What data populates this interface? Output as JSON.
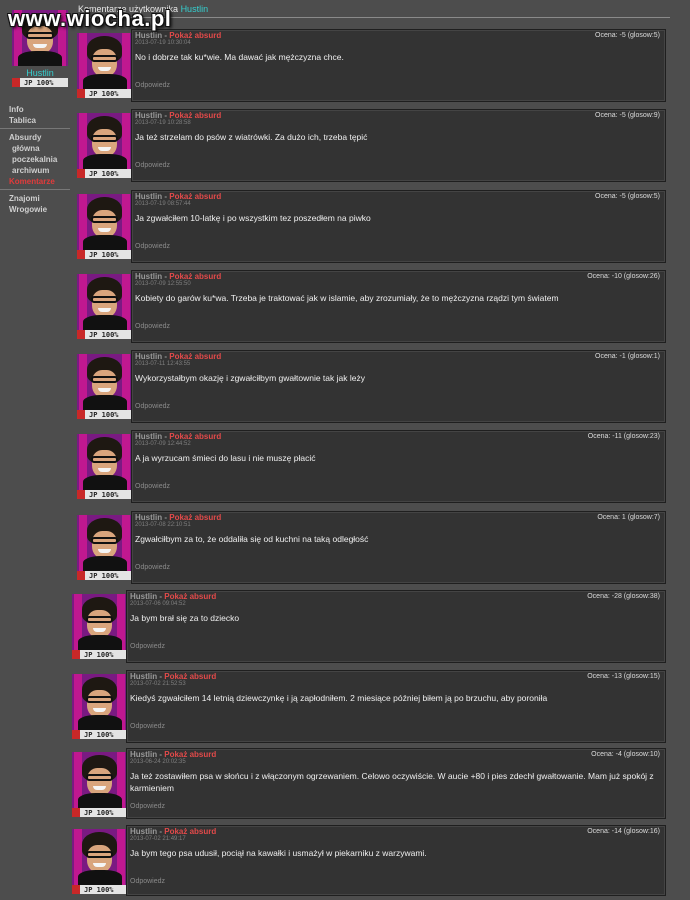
{
  "watermark": "www.wiocha.pl",
  "header": {
    "prefix": "Komentarze użytkownika",
    "user": "Hustlin"
  },
  "profile": {
    "name": "Hustlin",
    "jp": "JP 100%"
  },
  "sidebar": [
    {
      "label": "Info",
      "active": false,
      "sub": false
    },
    {
      "label": "Tablica",
      "active": false,
      "sub": false
    },
    {
      "label": "Absurdy",
      "active": false,
      "sub": false
    },
    {
      "label": "główna",
      "active": false,
      "sub": true
    },
    {
      "label": "poczekalnia",
      "active": false,
      "sub": true
    },
    {
      "label": "archiwum",
      "active": false,
      "sub": true
    },
    {
      "label": "Komentarze",
      "active": true,
      "sub": false
    },
    {
      "label": "Znajomi",
      "active": false,
      "sub": false
    },
    {
      "label": "Wrogowie",
      "active": false,
      "sub": false
    }
  ],
  "labels": {
    "absurd_link": "Pokaż absurd",
    "reply": "Odpowiedz",
    "separator": "-"
  },
  "colors": {
    "background": "#4d4d4d",
    "box": "#333333",
    "username": "#35d0d0",
    "absurd": "#e24a4a",
    "active_nav": "#e23b3b"
  },
  "comments": [
    {
      "user": "Hustlin",
      "time": "2013-07-19 10:30:04",
      "rating": "Ocena: -5 (glosow:5)",
      "text": "No i dobrze tak ku*wie. Ma dawać jak mężczyzna chce.",
      "jp": "JP 100%"
    },
    {
      "user": "Hustlin",
      "time": "2013-07-19 10:28:58",
      "rating": "Ocena: -5 (glosow:9)",
      "text": "Ja też strzelam do psów z wiatrówki. Za dużo ich, trzeba tępić",
      "jp": "JP 100%"
    },
    {
      "user": "Hustlin",
      "time": "2013-07-19 08:57:44",
      "rating": "Ocena: -5 (glosow:5)",
      "text": "Ja zgwałciłem 10-latkę i po wszystkim tez poszedłem na piwko",
      "jp": "JP 100%"
    },
    {
      "user": "Hustlin",
      "time": "2013-07-09 12:55:50",
      "rating": "Ocena: -10 (glosow:26)",
      "text": "Kobiety do garów ku*wa. Trzeba je traktować jak w islamie, aby zrozumiały, że to mężczyzna rządzi tym światem",
      "jp": "JP 100%"
    },
    {
      "user": "Hustlin",
      "time": "2013-07-11 12:43:55",
      "rating": "Ocena: -1 (glosow:1)",
      "text": "Wykorzystałbym okazję i zgwałciłbym gwałtownie tak jak leży",
      "jp": "JP 100%"
    },
    {
      "user": "Hustlin",
      "time": "2013-07-09 12:44:52",
      "rating": "Ocena: -11 (glosow:23)",
      "text": "A ja wyrzucam śmieci do lasu i nie muszę płacić",
      "jp": "JP 100%"
    },
    {
      "user": "Hustlin",
      "time": "2013-07-08 22:10:51",
      "rating": "Ocena: 1 (glosow:7)",
      "text": "Zgwałciłbym za to, że oddaliła się od kuchni na taką odległość",
      "jp": "JP 100%"
    },
    {
      "user": "Hustlin",
      "time": "2013-07-06 09:04:52",
      "rating": "Ocena: -28 (glosow:38)",
      "text": "Ja bym brał się za to dziecko",
      "jp": "JP 100%"
    },
    {
      "user": "Hustlin",
      "time": "2013-07-02 21:52:53",
      "rating": "Ocena: -13 (glosow:15)",
      "text": "Kiedyś zgwałciłem 14 letnią dziewczynkę i ją zapłodniłem. 2 miesiące później biłem ją po brzuchu, aby poroniła",
      "jp": "JP 100%"
    },
    {
      "user": "Hustlin",
      "time": "2013-06-24 20:02:35",
      "rating": "Ocena: -4 (glosow:10)",
      "text": "Ja też zostawiłem psa w słońcu i z włączonym ogrzewaniem. Celowo oczywiście. W aucie +80 i pies zdechł gwałtowanie. Mam już spokój z karmieniem",
      "jp": "JP 100%"
    },
    {
      "user": "Hustlin",
      "time": "2013-07-02 21:49:17",
      "rating": "Ocena: -14 (glosow:16)",
      "text": "Ja bym tego psa udusił, pociął na kawałki i usmażył w piekarniku z warzywami.",
      "jp": "JP 100%"
    }
  ]
}
